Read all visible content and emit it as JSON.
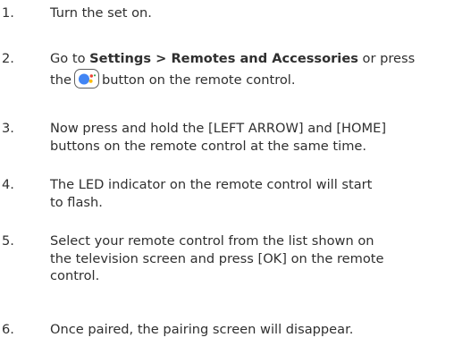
{
  "steps": [
    {
      "number": "1.",
      "text": "Turn the set on."
    },
    {
      "number": "2.",
      "line1_prefix": "Go to ",
      "bold_text": "Settings > Remotes and Accessories",
      "line1_suffix": " or press",
      "line2_prefix": "the",
      "icon": "google-assistant-icon",
      "line2_suffix": "button on the remote control."
    },
    {
      "number": "3.",
      "line1": "Now press and hold the [LEFT ARROW] and [HOME]",
      "line2": "buttons on the remote control at the same time."
    },
    {
      "number": "4.",
      "line1": "The LED indicator on the remote control will start",
      "line2": "to flash."
    },
    {
      "number": "5.",
      "line1": "Select your remote control from the list shown on",
      "line2": "the television screen and press [OK] on the remote",
      "line3": "control."
    },
    {
      "number": "6.",
      "text": "Once paired, the pairing screen will disappear."
    }
  ],
  "colors": {
    "text": "#2f2f2f",
    "assistant_blue": "#4285F4",
    "assistant_red": "#EA4335",
    "assistant_yellow": "#FBBC05",
    "assistant_green": "#34A853"
  }
}
